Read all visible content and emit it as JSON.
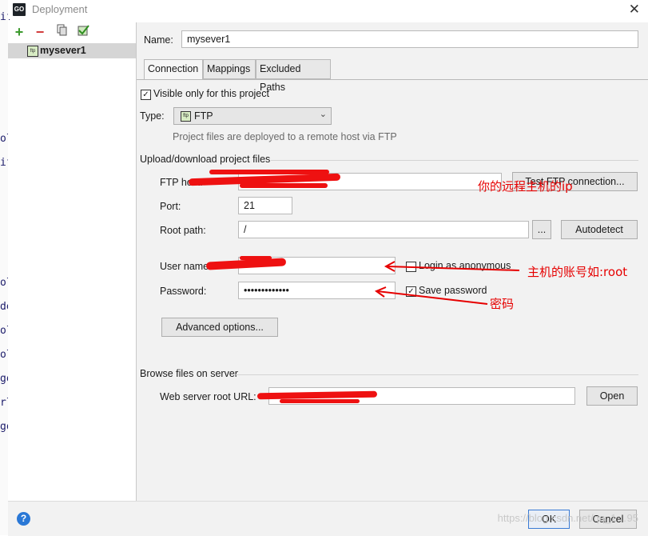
{
  "window": {
    "title": "Deployment",
    "app_icon_text": "GO"
  },
  "background_editor": {
    "edge_chars": [
      "if",
      "ol",
      "if",
      "ol",
      "de",
      "ol",
      "ol",
      "go",
      "rl",
      "go"
    ]
  },
  "left_pane": {
    "toolbar": {
      "add": "+",
      "remove": "−",
      "copy_icon": "copy-icon",
      "default_icon": "set-default-icon"
    },
    "server": {
      "name": "mysever1",
      "icon_text": "ftp"
    }
  },
  "form": {
    "name_label": "Name:",
    "name_value": "mysever1",
    "tabs": [
      "Connection",
      "Mappings",
      "Excluded Paths"
    ],
    "visible_only_label": "Visible only for this project",
    "visible_only_checked": true,
    "type_label": "Type:",
    "type_value": "FTP",
    "type_icon_text": "ftp",
    "type_hint": "Project files are deployed to a remote host via FTP",
    "upload_section": "Upload/download project files",
    "ftp_host_label": "FTP host:",
    "test_button": "Test FTP connection...",
    "port_label": "Port:",
    "port_value": "21",
    "root_path_label": "Root path:",
    "root_path_value": "/",
    "browse_button": "...",
    "autodetect_button": "Autodetect",
    "user_name_label": "User name:",
    "login_anon_label": "Login as anonymous",
    "login_anon_checked": false,
    "password_label": "Password:",
    "password_value": "•••••••••••••",
    "save_password_label": "Save password",
    "save_password_checked": true,
    "advanced_button": "Advanced options...",
    "browse_section": "Browse files on server",
    "web_root_label": "Web server root URL:",
    "open_button": "Open"
  },
  "bottom": {
    "help": "?",
    "ok": "OK",
    "cancel": "Cancel"
  },
  "annotations": {
    "host_note": "你的远程主机的ip",
    "account_note": "主机的账号如:root",
    "password_note": "密码",
    "color": "#e60000"
  },
  "watermark": "https://blog.csdn.net/qq_1…95"
}
